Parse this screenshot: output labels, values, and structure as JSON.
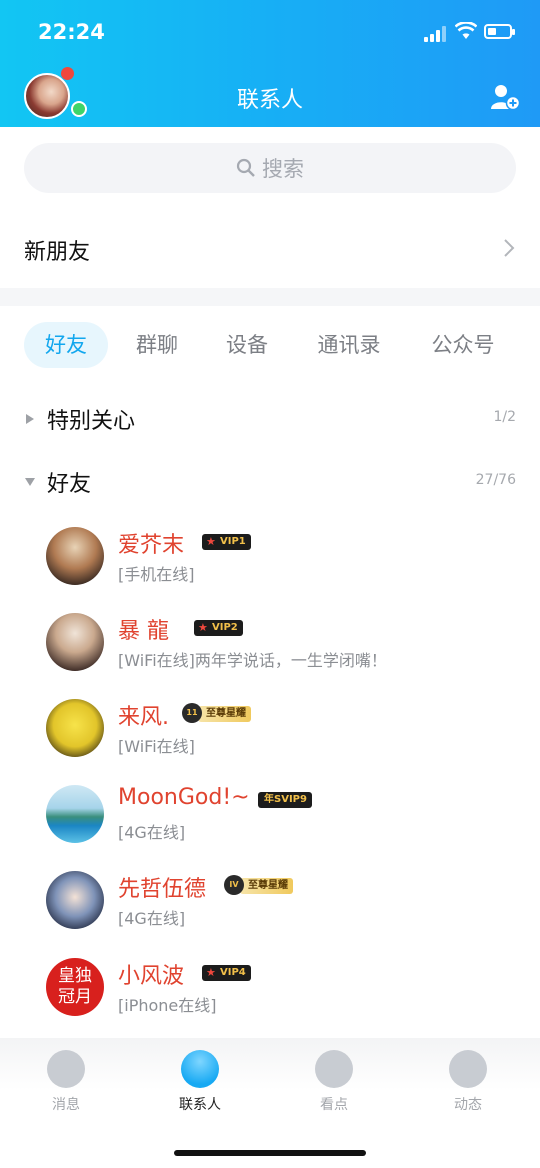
{
  "status_bar": {
    "time": "22:24"
  },
  "header": {
    "title": "联系人"
  },
  "search": {
    "placeholder": "搜索"
  },
  "new_friends": {
    "label": "新朋友"
  },
  "tabs": [
    {
      "label": "好友",
      "active": true
    },
    {
      "label": "群聊",
      "active": false
    },
    {
      "label": "设备",
      "active": false
    },
    {
      "label": "通讯录",
      "active": false
    },
    {
      "label": "公众号",
      "active": false
    }
  ],
  "groups": [
    {
      "name": "特别关心",
      "count": "1/2",
      "expanded": false
    },
    {
      "name": "好友",
      "count": "27/76",
      "expanded": true
    }
  ],
  "friends": [
    {
      "name": "爱芥末",
      "status": "[手机在线]",
      "badge": "VIP1"
    },
    {
      "name": "暴  龍",
      "status": "[WiFi在线]两年学说话，一生学闭嘴！",
      "badge": "VIP2"
    },
    {
      "name": "来风.",
      "status": "[WiFi在线]",
      "badge": "至尊星耀",
      "emblem": "11"
    },
    {
      "name": "MoonGod!~",
      "status": "[4G在线]",
      "badge": "年SVIP9"
    },
    {
      "name": "先哲伍德",
      "status": "[4G在线]",
      "badge": "至尊星耀",
      "emblem": "IV"
    },
    {
      "name": "小风波",
      "status": "[iPhone在线]",
      "badge": "VIP4",
      "avatar_text": "皇独冠月"
    }
  ],
  "tabbar": [
    {
      "label": "消息",
      "icon": "message-icon",
      "active": false
    },
    {
      "label": "联系人",
      "icon": "contacts-icon",
      "active": true
    },
    {
      "label": "看点",
      "icon": "eye-icon",
      "active": false
    },
    {
      "label": "动态",
      "icon": "planet-star-icon",
      "active": false
    }
  ],
  "colors": {
    "accent": "#12a7ee",
    "header_start": "#12c6f3",
    "header_end": "#1f9af6",
    "vip_name": "#e0432f"
  }
}
